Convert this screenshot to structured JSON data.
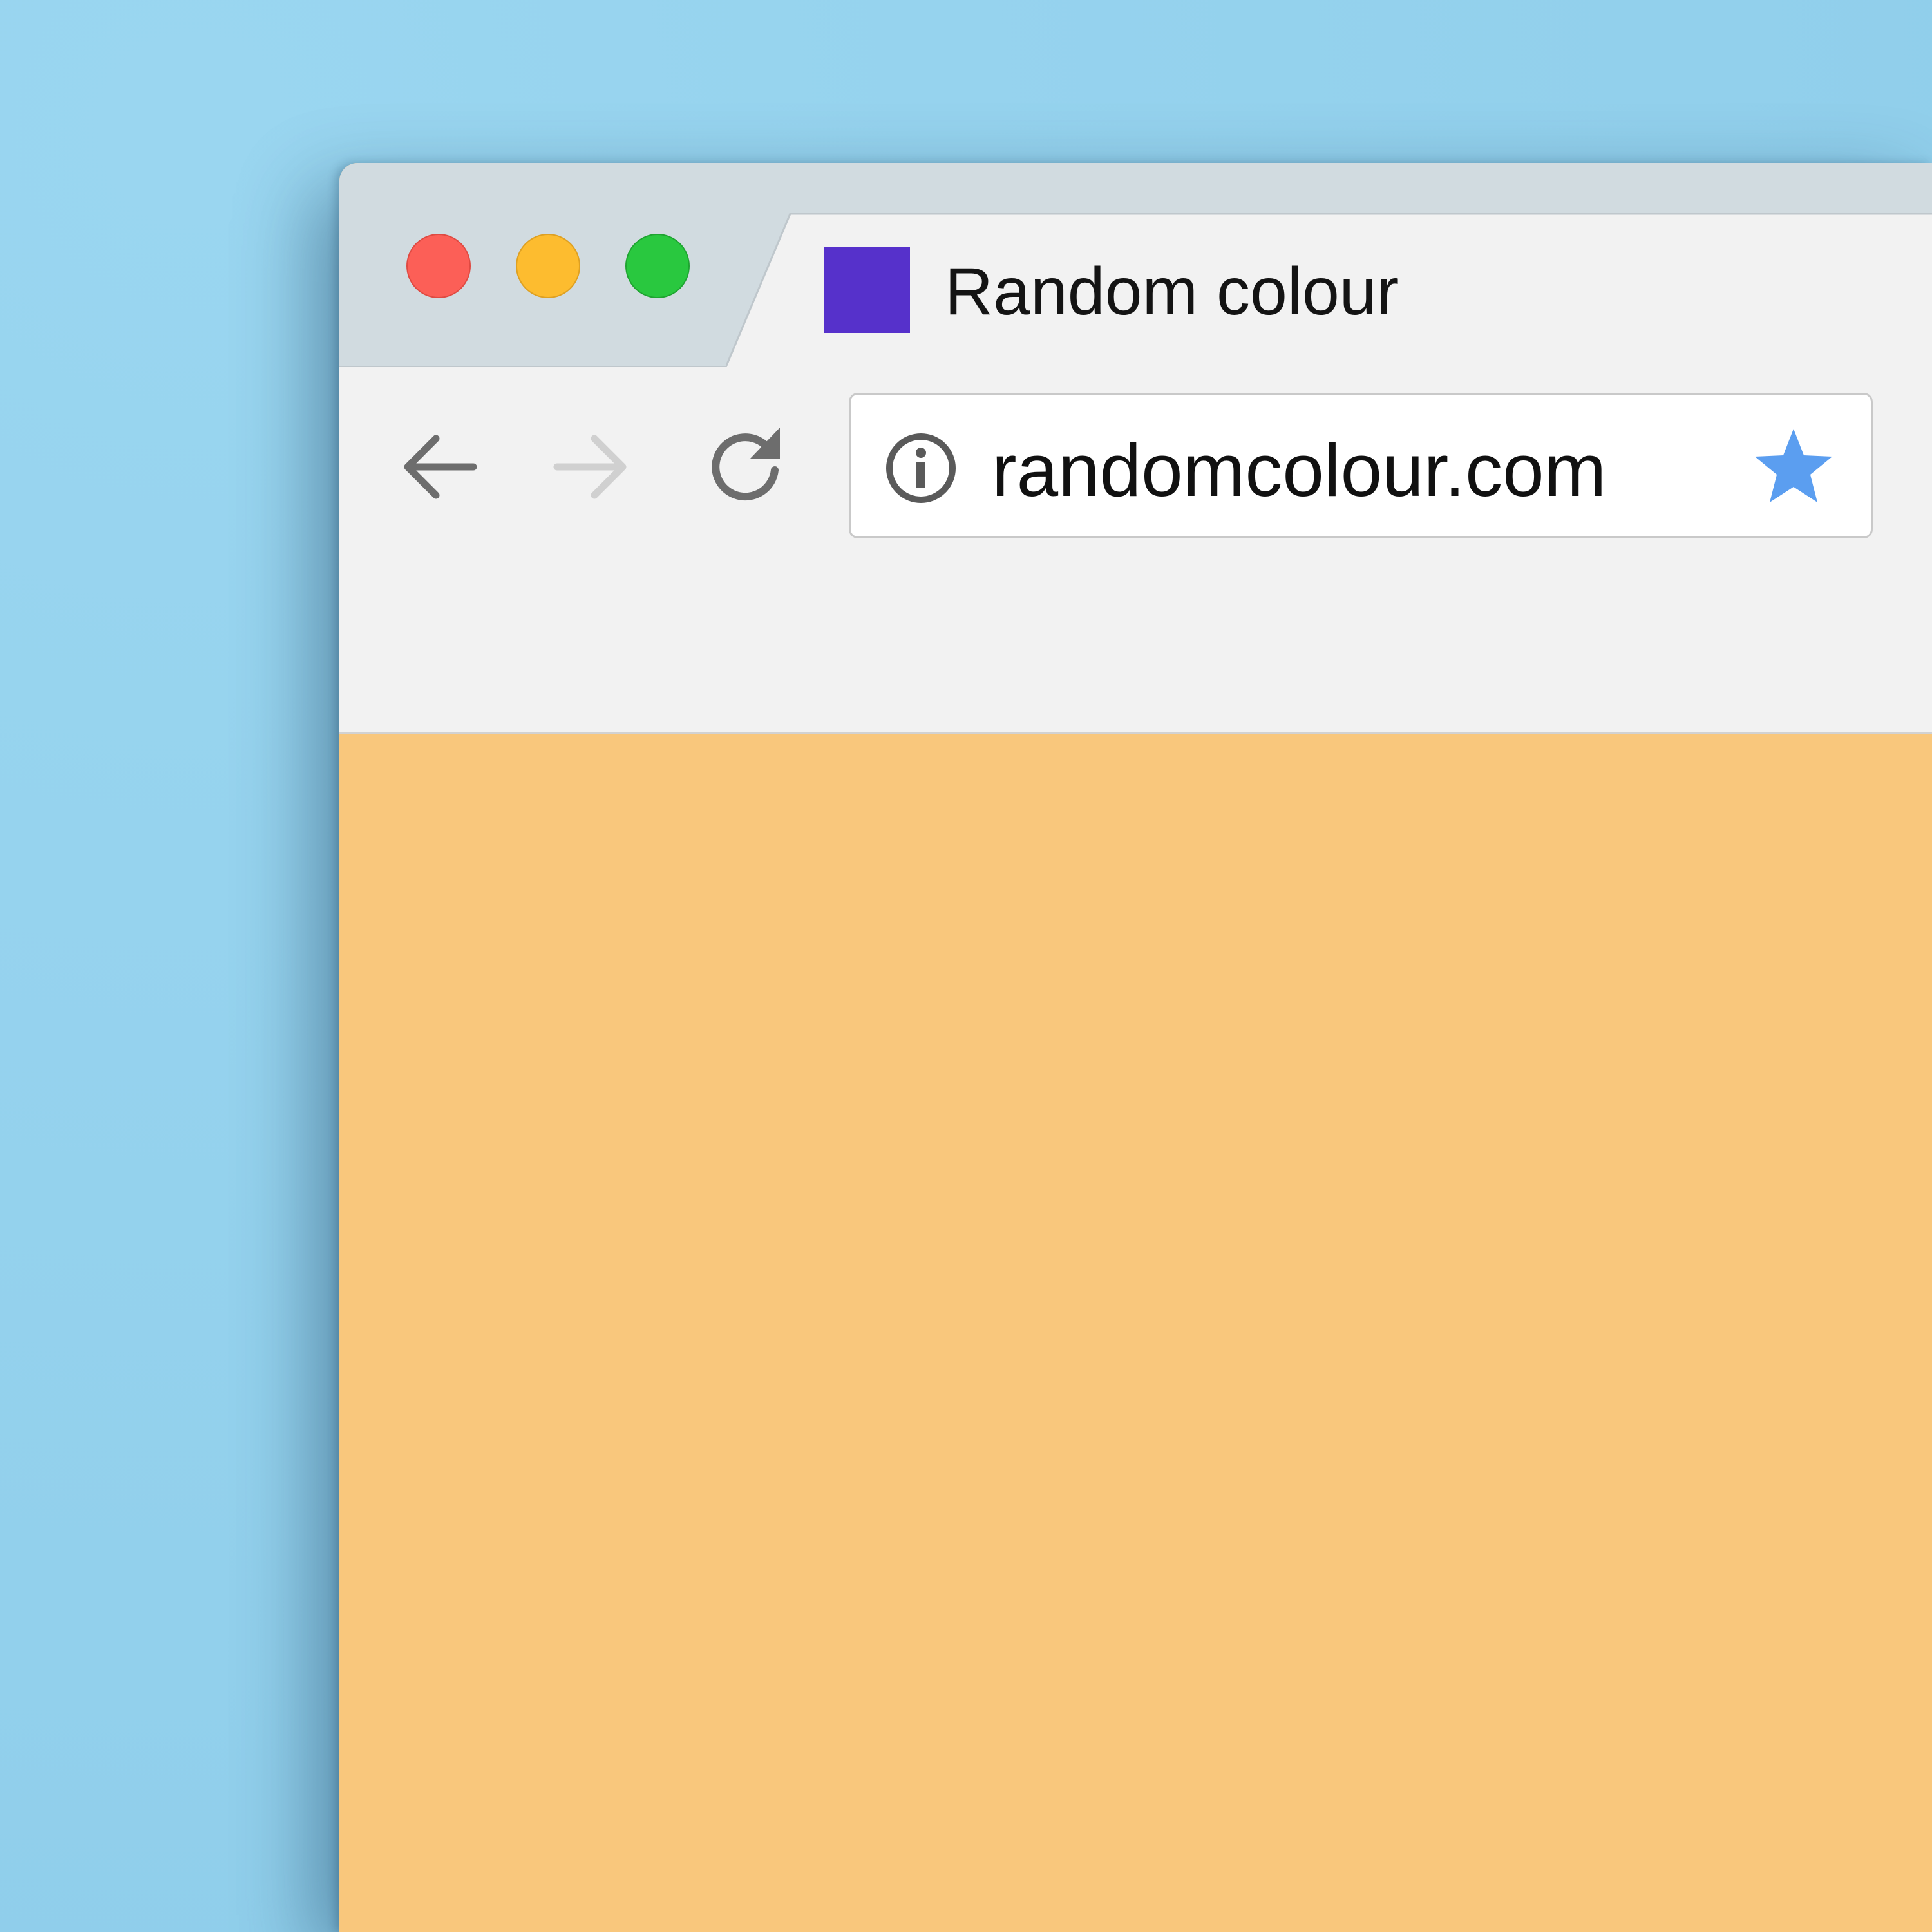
{
  "colors": {
    "desktop_background": "#94d1ec",
    "page_background": "#f9c77c",
    "favicon": "#5631cb",
    "bookmark_star": "#5b9ef0"
  },
  "window": {
    "controls": [
      "close",
      "minimize",
      "maximize"
    ]
  },
  "tab": {
    "title": "Random colour",
    "close_label": "×",
    "favicon_icon": "square-favicon-icon"
  },
  "toolbar": {
    "back_icon": "back-arrow-icon",
    "forward_icon": "forward-arrow-icon",
    "reload_icon": "reload-icon"
  },
  "omnibox": {
    "url": "randomcolour.com",
    "security_icon": "info-icon",
    "bookmark_icon": "star-icon",
    "bookmarked": true
  }
}
